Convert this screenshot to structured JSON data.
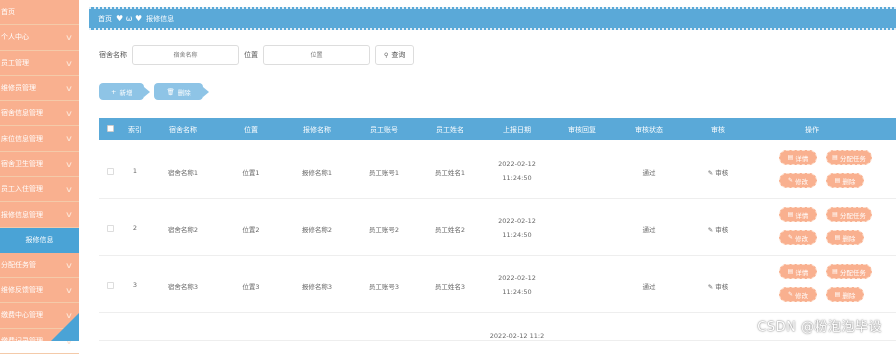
{
  "sidebar": {
    "items": [
      {
        "label": "首页"
      },
      {
        "label": "个人中心"
      },
      {
        "label": "员工管理"
      },
      {
        "label": "维修员管理"
      },
      {
        "label": "宿舍信息管理"
      },
      {
        "label": "床位信息管理"
      },
      {
        "label": "宿舍卫生管理"
      },
      {
        "label": "员工入住管理"
      },
      {
        "label": "报修信息管理"
      }
    ],
    "active_sub": "报修信息",
    "items_after": [
      {
        "label": "分配任务管"
      },
      {
        "label": "维修反馈管理"
      },
      {
        "label": "缴费中心管理"
      },
      {
        "label": "缴费记录管理"
      }
    ]
  },
  "breadcrumb": {
    "home": "首页",
    "current": "报修信息",
    "deco": "♥ ω ♥"
  },
  "search": {
    "label1": "宿舍名称",
    "placeholder1": "宿舍名称",
    "label2": "位置",
    "placeholder2": "位置",
    "button": "查询"
  },
  "actions": {
    "add": "新增",
    "delete": "删除"
  },
  "table": {
    "headers": [
      "索引",
      "宿舍名称",
      "位置",
      "报修名称",
      "员工账号",
      "员工姓名",
      "上报日期",
      "审核回复",
      "审核状态",
      "审核",
      "操作"
    ],
    "rows": [
      {
        "index": "1",
        "dorm": "宿舍名称1",
        "location": "位置1",
        "repair": "报修名称1",
        "account": "员工账号1",
        "name": "员工姓名1",
        "date": "2022-02-12 11:24:50",
        "reply": "",
        "status": "通过",
        "audit": "审核"
      },
      {
        "index": "2",
        "dorm": "宿舍名称2",
        "location": "位置2",
        "repair": "报修名称2",
        "account": "员工账号2",
        "name": "员工姓名2",
        "date": "2022-02-12 11:24:50",
        "reply": "",
        "status": "通过",
        "audit": "审核"
      },
      {
        "index": "3",
        "dorm": "宿舍名称3",
        "location": "位置3",
        "repair": "报修名称3",
        "account": "员工账号3",
        "name": "员工姓名3",
        "date": "2022-02-12 11:24:50",
        "reply": "",
        "status": "通过",
        "audit": "审核"
      }
    ],
    "ops": {
      "detail": "详情",
      "assign": "分配任务",
      "edit": "修改",
      "remove": "删除"
    },
    "partial_date": "2022-02-12 11:2"
  },
  "watermark": "CSDN @粉泡泡毕设"
}
